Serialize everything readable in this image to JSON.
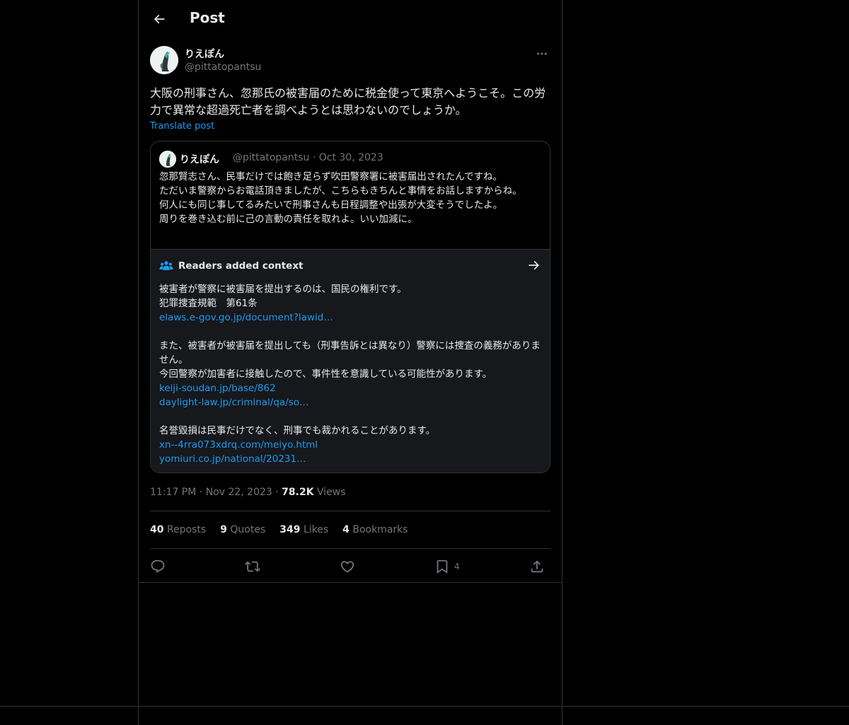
{
  "header": {
    "title": "Post"
  },
  "author": {
    "name": "りえぽん",
    "handle": "@pittatopantsu"
  },
  "post": {
    "text": "大阪の刑事さん、忽那氏の被害届のために税金使って東京へようこそ。この労力で異常な超過死亡者を調べようとは思わないのでしょうか。",
    "translate_label": "Translate post"
  },
  "quote": {
    "name": "りえぽん",
    "meta": "@pittatopantsu · Oct 30, 2023",
    "text": "忽那賢志さん、民事だけでは飽き足らず吹田警察署に被害届出されたんですね。\nただいま警察からお電話頂きましたが、こちらもきちんと事情をお話しますからね。\n何人にも同じ事してるみたいで刑事さんも日程調整や出張が大変そうでしたよ。\n周りを巻き込む前に己の言動の責任を取れよ。いい加減に。"
  },
  "context": {
    "title": "Readers added context",
    "lines": [
      {
        "text": "被害者が警察に被害届を提出するのは、国民の権利です。",
        "link": false
      },
      {
        "text": "犯罪捜査規範　第61条",
        "link": false
      },
      {
        "text": "elaws.e-gov.go.jp/document?lawid…",
        "link": true
      },
      {
        "text": "",
        "link": false
      },
      {
        "text": "また、被害者が被害届を提出しても（刑事告訴とは異なり）警察には捜査の義務がありません。",
        "link": false
      },
      {
        "text": "今回警察が加害者に接触したので、事件性を意識している可能性があります。",
        "link": false
      },
      {
        "text": "keiji-soudan.jp/base/862",
        "link": true
      },
      {
        "text": "daylight-law.jp/criminal/qa/so…",
        "link": true
      },
      {
        "text": "",
        "link": false
      },
      {
        "text": "名誉毀損は民事だけでなく、刑事でも裁かれることがあります。",
        "link": false
      },
      {
        "text": "xn--4rra073xdrq.com/meiyo.html",
        "link": true
      },
      {
        "text": "yomiuri.co.jp/national/20231…",
        "link": true
      }
    ]
  },
  "meta": {
    "time": "11:17 PM",
    "date": "Nov 22, 2023",
    "views_count": "78.2K",
    "views_label": "Views"
  },
  "stats": [
    {
      "count": "40",
      "label": "Reposts"
    },
    {
      "count": "9",
      "label": "Quotes"
    },
    {
      "count": "349",
      "label": "Likes"
    },
    {
      "count": "4",
      "label": "Bookmarks"
    }
  ],
  "actions": {
    "bookmark_count": "4"
  },
  "icons": [
    "back-arrow-icon",
    "more-icon",
    "readers-icon",
    "arrow-right-icon",
    "reply-icon",
    "repost-icon",
    "like-icon",
    "bookmark-icon",
    "share-icon"
  ],
  "colors": {
    "background": "#000000",
    "text": "#e7e9ea",
    "muted": "#71767b",
    "link": "#1d9bf0",
    "border": "#2f3336"
  }
}
